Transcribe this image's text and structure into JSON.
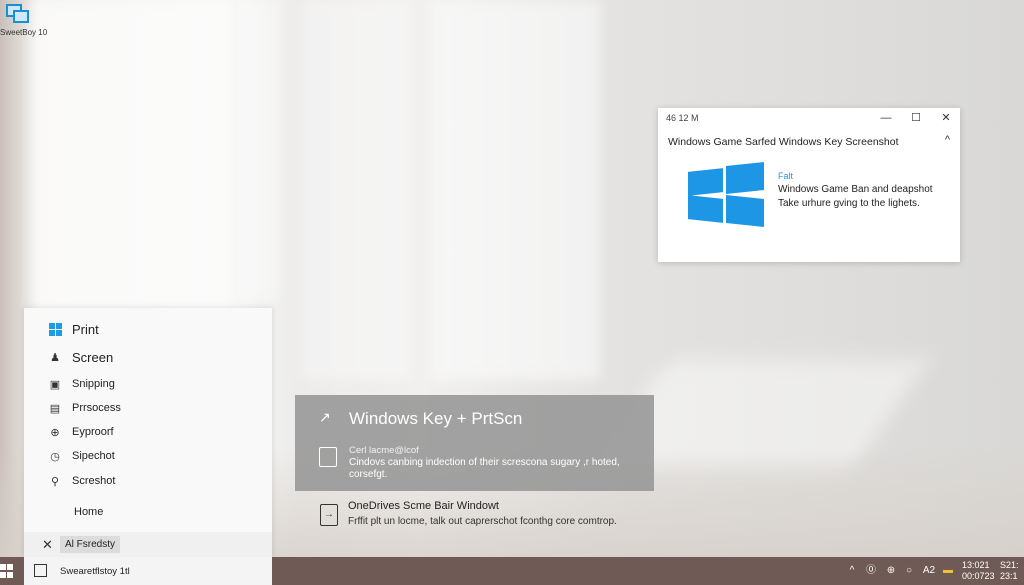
{
  "desktop": {
    "icon_label": "SweetBoy 10"
  },
  "start_menu": {
    "items": [
      {
        "label": "Print",
        "icon": "windows-logo-icon"
      },
      {
        "label": "Screen",
        "icon": "person-icon"
      },
      {
        "label": "Snipping",
        "icon": "snip-icon"
      },
      {
        "label": "Prrsocess",
        "icon": "process-icon"
      },
      {
        "label": "Eyproorf",
        "icon": "globe-icon"
      },
      {
        "label": "Sipechot",
        "icon": "clock-icon"
      },
      {
        "label": "Screshot",
        "icon": "search-icon"
      },
      {
        "label": "Home",
        "icon": ""
      }
    ],
    "bottom_badge": "Al Fsredsty",
    "close_glyph": "✕"
  },
  "popup": {
    "time": "46 12 M",
    "heading": "Windows Game Sarfed Windows Key Screenshot",
    "line1": "Falt",
    "line2": "Windows Game Ban and deapshot",
    "line3": "Take urhure gving to the lighets.",
    "minimize_glyph": "—",
    "maximize_glyph": "☐",
    "close_glyph": "✕",
    "collapse_glyph": "^",
    "accent": "#1d97e5"
  },
  "gray_card": {
    "title": "Windows Key + PrtScn",
    "subtitle": "Cerl lacme@lcof",
    "body": "Cindovs canbing indection of their screscona sugary ,r hoted, corsefgt."
  },
  "tip": {
    "title": "OneDrives Scme Bair Windowt",
    "body": "Frffit plt un locme, talk out caprerschot fconthg core comtrop."
  },
  "taskbar": {
    "search_text": "Swearetflstoy 1tl",
    "tray": [
      "^",
      "⓪",
      "⊕",
      "○",
      "▭",
      "A2",
      "▬"
    ],
    "clock_time": "13:021",
    "clock_date": "00:0723",
    "clock_right_top": "S21:",
    "clock_right_bottom": "23:1",
    "color": "#6f5a55"
  }
}
